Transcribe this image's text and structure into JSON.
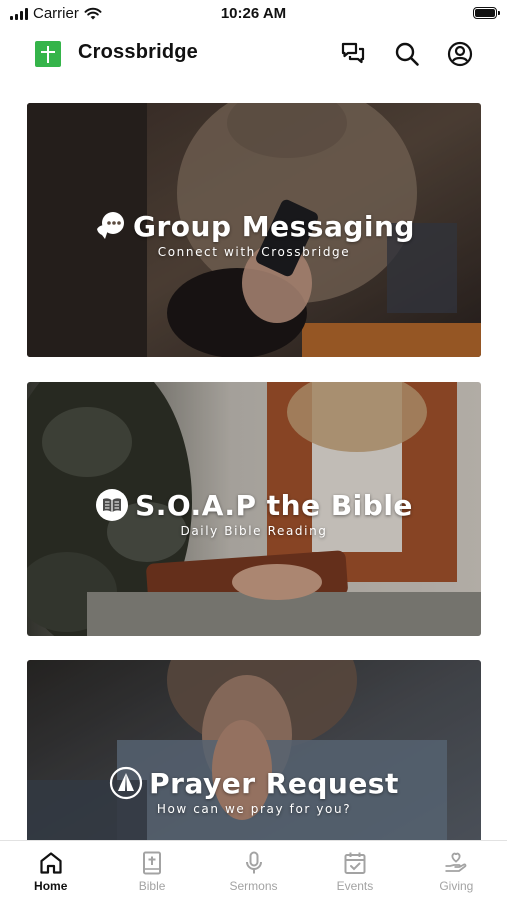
{
  "status_bar": {
    "carrier": "Carrier",
    "time": "10:26 AM"
  },
  "header": {
    "title": "Crossbridge",
    "brand_color": "#35b44a"
  },
  "cards": [
    {
      "title": "Group Messaging",
      "subtitle": "Connect with Crossbridge",
      "icon": "chat-bubbles-icon"
    },
    {
      "title": "S.O.A.P the Bible",
      "subtitle": "Daily Bible Reading",
      "icon": "open-book-icon"
    },
    {
      "title": "Prayer Request",
      "subtitle": "How can we pray for you?",
      "icon": "praying-hands-icon"
    }
  ],
  "tabs": [
    {
      "label": "Home",
      "icon": "home-icon",
      "active": true
    },
    {
      "label": "Bible",
      "icon": "bible-icon",
      "active": false
    },
    {
      "label": "Sermons",
      "icon": "microphone-icon",
      "active": false
    },
    {
      "label": "Events",
      "icon": "calendar-icon",
      "active": false
    },
    {
      "label": "Giving",
      "icon": "giving-hand-icon",
      "active": false
    }
  ],
  "colors": {
    "tab_active": "#111111",
    "tab_inactive": "#a3a3a3"
  }
}
